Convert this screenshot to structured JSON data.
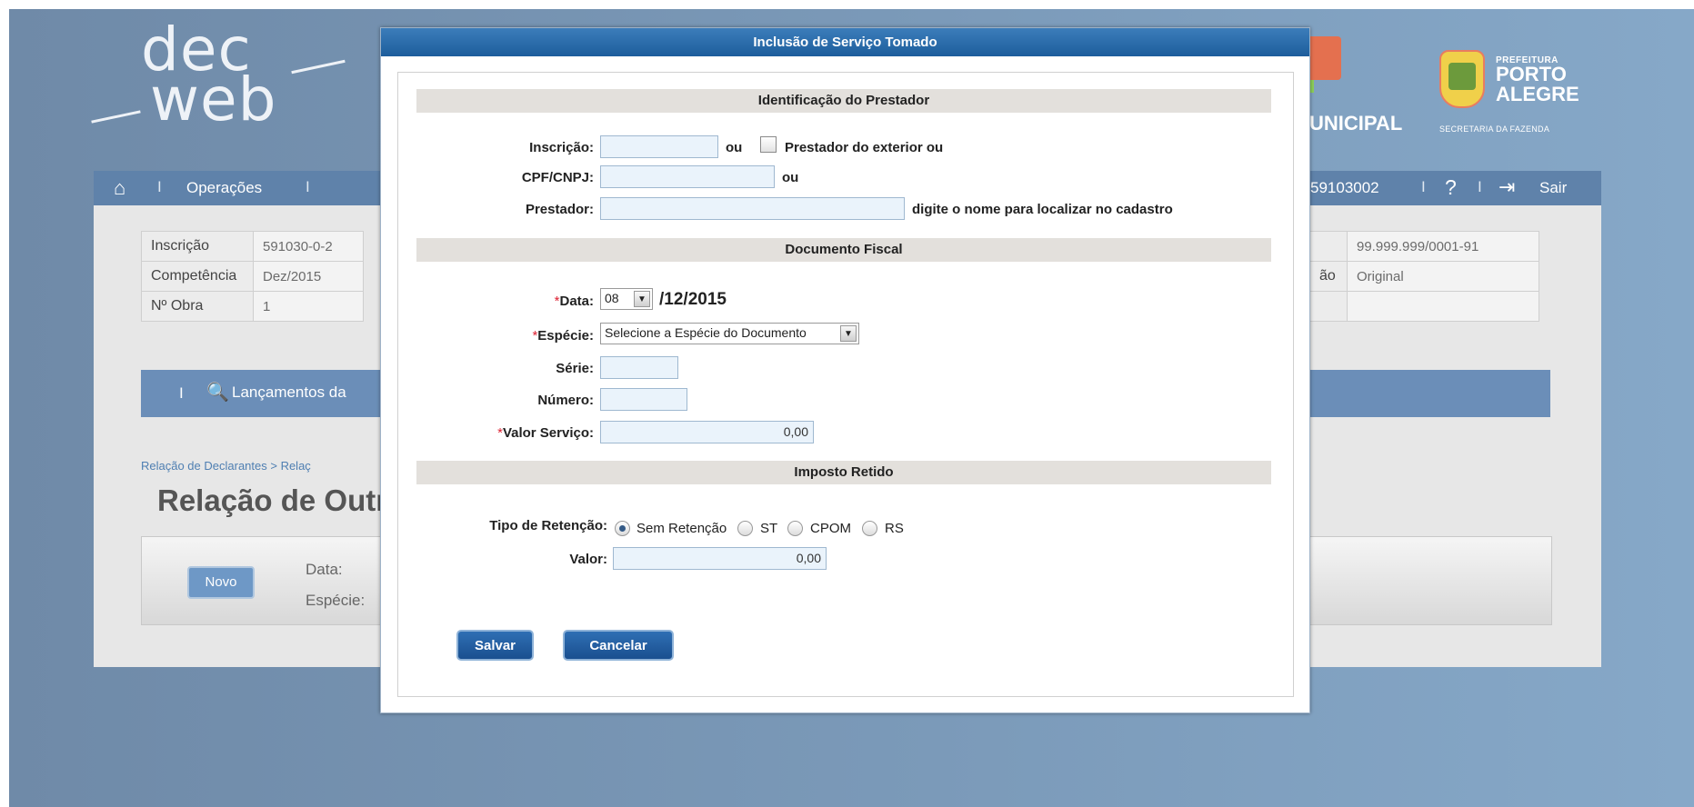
{
  "header": {
    "logo_line1": "dec",
    "logo_line2": "web",
    "municipal": "UNICIPAL",
    "prefeitura_small": "PREFEITURA",
    "prefeitura_big1": "PORTO",
    "prefeitura_big2": "ALEGRE",
    "secretaria": "SECRETARIA DA FAZENDA"
  },
  "nav": {
    "operacoes": "Operações",
    "separator": "I",
    "inscricao_partial": "59103002",
    "sair": "Sair"
  },
  "info": {
    "rows": [
      {
        "label": "Inscrição",
        "value": "591030-0-2",
        "right_label": "",
        "right_value": "99.999.999/0001-91"
      },
      {
        "label": "Competência",
        "value": "Dez/2015",
        "right_label": "ão",
        "right_value": "Original"
      },
      {
        "label": "Nº Obra",
        "value": "1",
        "right_label": "",
        "right_value": ""
      }
    ]
  },
  "band": {
    "lancamentos": "Lançamentos da"
  },
  "breadcrumb": "Relação de Declarantes > Relaç",
  "page_title": "Relação de Outr",
  "filter": {
    "novo_label": "Novo",
    "data_label": "Data:",
    "especie_label": "Espécie:"
  },
  "modal": {
    "title": "Inclusão de Serviço Tomado",
    "sec_prestador": "Identificação do Prestador",
    "inscricao_label": "Inscrição:",
    "ou1": "ou",
    "exterior_label": "Prestador do exterior ou",
    "cpf_label": "CPF/CNPJ:",
    "ou2": "ou",
    "prestador_label": "Prestador:",
    "prestador_hint": "digite o nome para localizar no cadastro",
    "sec_documento": "Documento Fiscal",
    "asterisk": "*",
    "data_label": "Data:",
    "data_day": "08",
    "data_rest": "/12/2015",
    "especie_label": "Espécie:",
    "especie_value": "Selecione a Espécie do Documento",
    "serie_label": "Série:",
    "numero_label": "Número:",
    "valor_servico_label": "Valor Serviço:",
    "valor_servico_value": "0,00",
    "sec_imposto": "Imposto Retido",
    "tipo_retencao_label": "Tipo de Retenção:",
    "ret_options": [
      "Sem Retenção",
      "ST",
      "CPOM",
      "RS"
    ],
    "ret_selected": "Sem Retenção",
    "valor_label": "Valor:",
    "valor_value": "0,00",
    "salvar": "Salvar",
    "cancelar": "Cancelar"
  }
}
